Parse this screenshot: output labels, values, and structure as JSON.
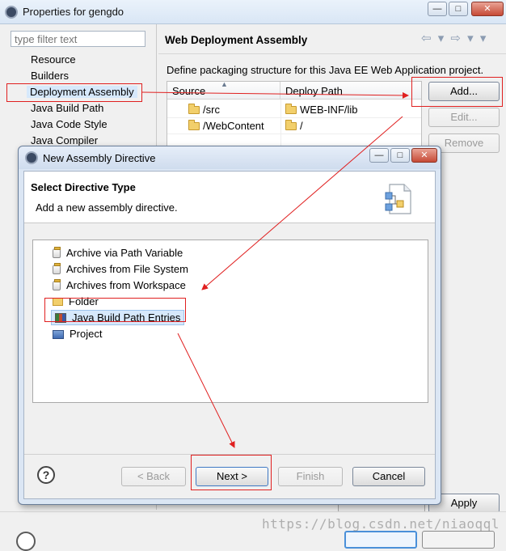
{
  "window": {
    "title": "Properties for gengdo",
    "min_glyph": "—",
    "max_glyph": "□",
    "close_glyph": "✕"
  },
  "sidebar": {
    "filter_placeholder": "type filter text",
    "items": [
      {
        "label": "Resource"
      },
      {
        "label": "Builders"
      },
      {
        "label": "Deployment Assembly",
        "selected": true
      },
      {
        "label": "Java Build Path"
      },
      {
        "label": "Java Code Style"
      },
      {
        "label": "Java Compiler"
      }
    ]
  },
  "page": {
    "title": "Web Deployment Assembly",
    "description": "Define packaging structure for this Java EE Web Application project.",
    "nav_glyphs": "⇦ ▾ ⇨ ▾ ▾",
    "table": {
      "headers": {
        "source": "Source",
        "deploy_path": "Deploy Path"
      },
      "rows": [
        {
          "source": "/src",
          "deploy_path": "WEB-INF/lib"
        },
        {
          "source": "/WebContent",
          "deploy_path": "/"
        }
      ]
    },
    "buttons": {
      "add": "Add...",
      "edit": "Edit...",
      "remove": "Remove",
      "apply": "Apply"
    }
  },
  "dialog": {
    "title": "New Assembly Directive",
    "heading": "Select Directive Type",
    "subheading": "Add a new assembly directive.",
    "items": [
      {
        "label": "Archive via Path Variable",
        "icon": "jar-icon"
      },
      {
        "label": "Archives from File System",
        "icon": "jar-icon"
      },
      {
        "label": "Archives from Workspace",
        "icon": "jar-icon"
      },
      {
        "label": "Folder",
        "icon": "folder-icon"
      },
      {
        "label": "Java Build Path Entries",
        "icon": "library-icon",
        "selected": true
      },
      {
        "label": "Project",
        "icon": "project-icon"
      }
    ],
    "help_glyph": "?",
    "buttons": {
      "back": "< Back",
      "next": "Next >",
      "finish": "Finish",
      "cancel": "Cancel"
    }
  },
  "watermark": "https://blog.csdn.net/niaoqql",
  "colors": {
    "annotation": "#e02020",
    "selection": "#d6e8fb"
  }
}
